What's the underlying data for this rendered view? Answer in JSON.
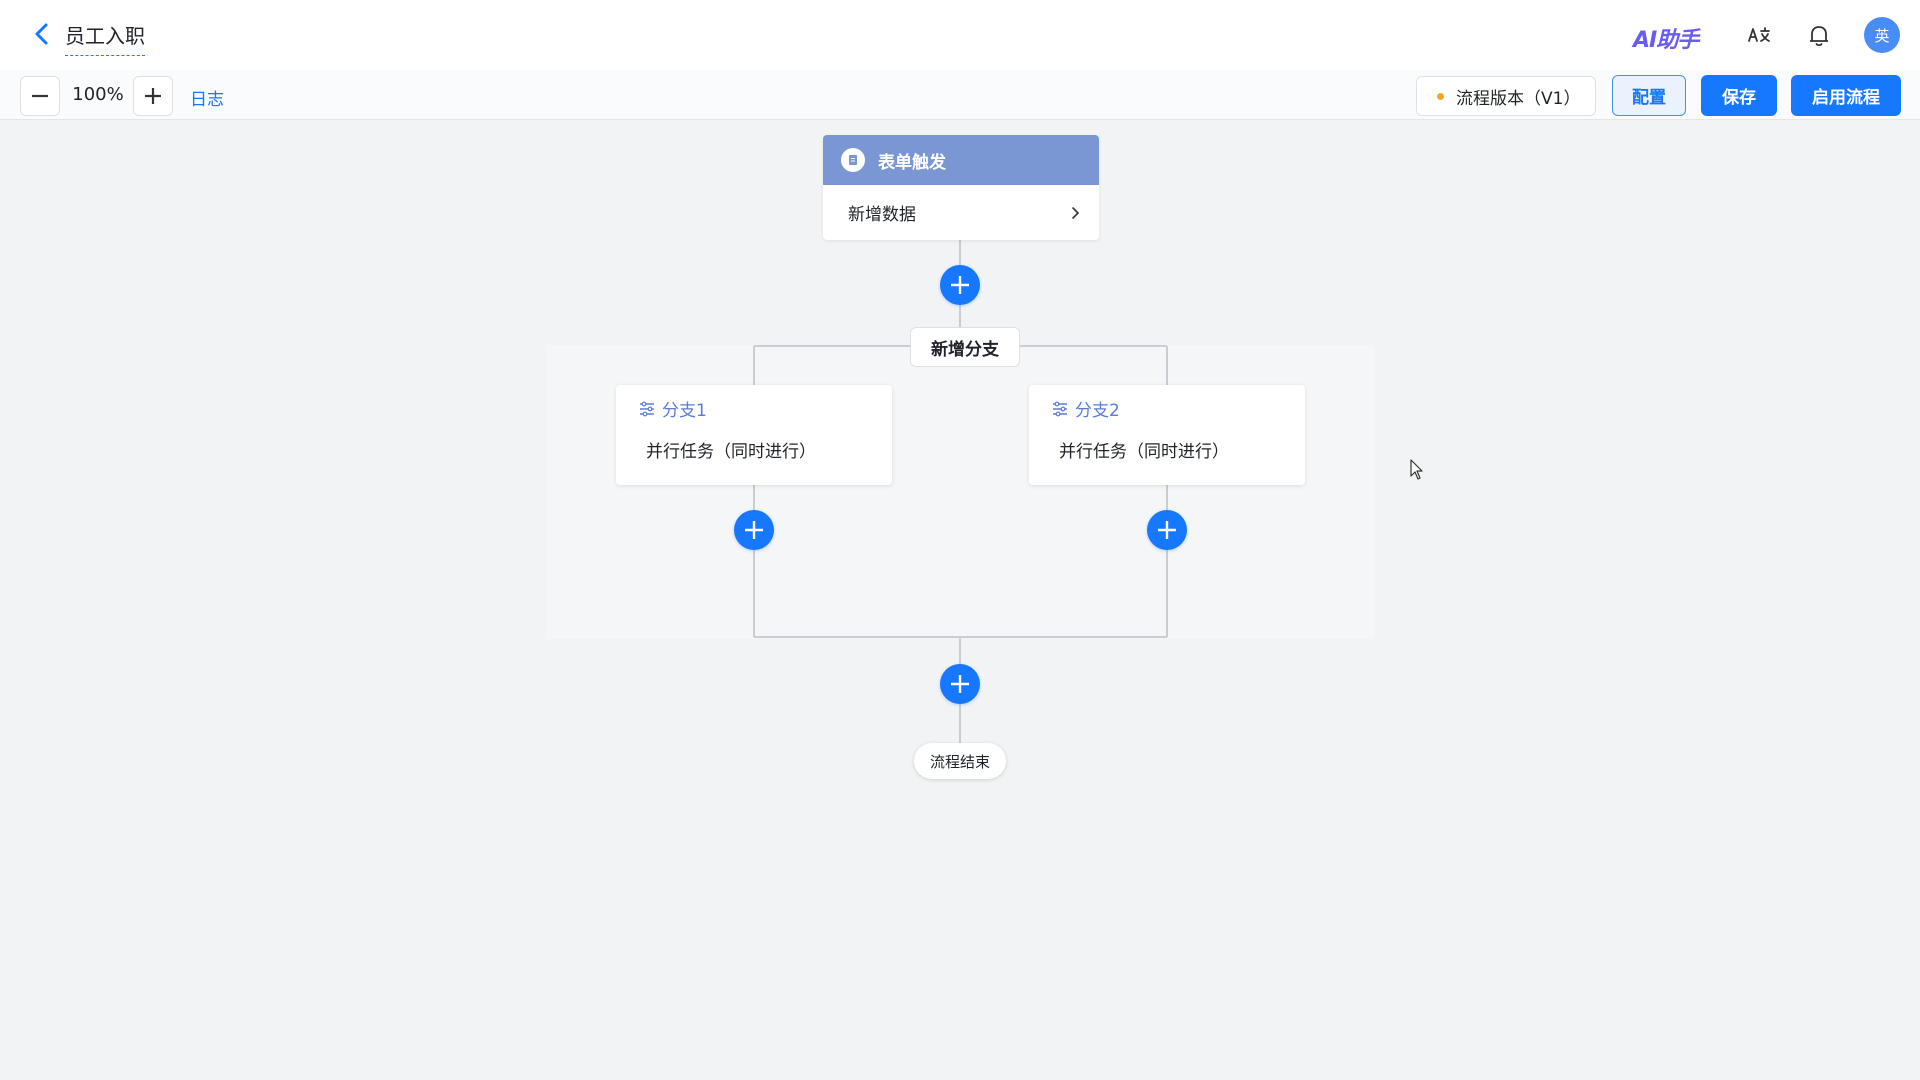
{
  "header": {
    "title": "员工入职",
    "ai_assistant_label": "AI助手",
    "avatar_text": "英"
  },
  "toolbar": {
    "zoom_value": "100%",
    "log_label": "日志",
    "version_label": "流程版本（V1）",
    "config_label": "配置",
    "save_label": "保存",
    "start_label": "启用流程"
  },
  "flow": {
    "trigger": {
      "title": "表单触发",
      "action": "新增数据"
    },
    "add_branch_label": "新增分支",
    "branches": [
      {
        "name": "分支1",
        "desc": "并行任务（同时进行）"
      },
      {
        "name": "分支2",
        "desc": "并行任务（同时进行）"
      }
    ],
    "end_label": "流程结束"
  },
  "colors": {
    "primary": "#1677ff",
    "trigger_header": "#7a97d4",
    "branch_title": "#5b7bd6",
    "version_dot": "#f5a623",
    "canvas_bg": "#f2f3f5"
  }
}
